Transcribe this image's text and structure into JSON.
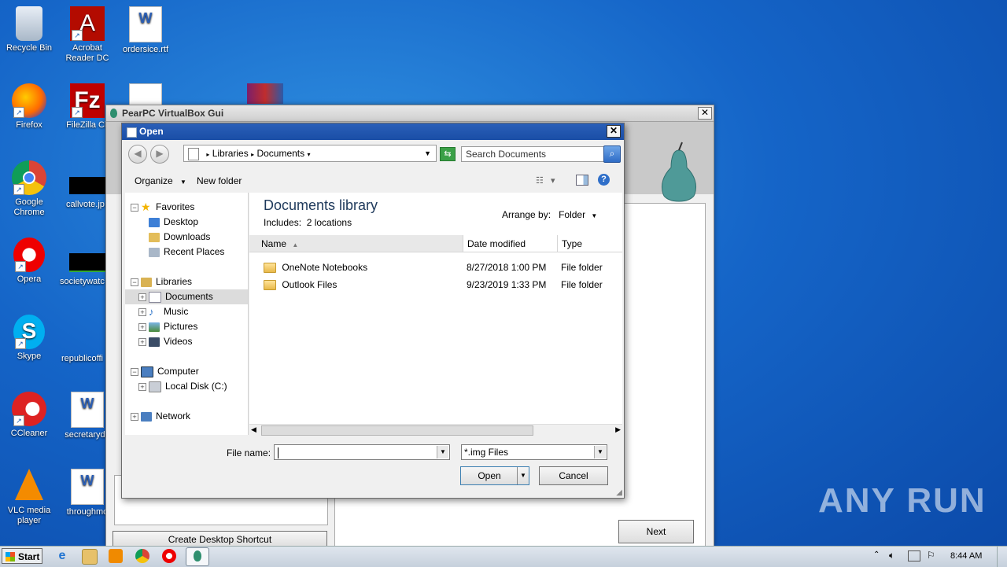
{
  "desktop": {
    "icons": [
      {
        "label": "Recycle Bin"
      },
      {
        "label": "Acrobat\nReader DC"
      },
      {
        "label": "ordersice.rtf"
      },
      {
        "label": "Firefox"
      },
      {
        "label": "FileZilla Cli"
      },
      {
        "label": "Google\nChrome"
      },
      {
        "label": "callvote.jp"
      },
      {
        "label": "Opera"
      },
      {
        "label": "societywatc"
      },
      {
        "label": "Skype"
      },
      {
        "label": "republicoffi"
      },
      {
        "label": "CCleaner"
      },
      {
        "label": "secretaryde"
      },
      {
        "label": "VLC media\nplayer"
      },
      {
        "label": "throughmo"
      }
    ],
    "watermark": "ANY  RUN"
  },
  "pear_window": {
    "title": "PearPC VirtualBox Gui",
    "create_shortcut_label": "Create Desktop Shortcut",
    "next_label": "Next"
  },
  "open_dialog": {
    "title": "Open",
    "breadcrumb": [
      "Libraries",
      "Documents"
    ],
    "search_placeholder": "Search Documents",
    "toolbar": {
      "organize": "Organize",
      "new_folder": "New folder"
    },
    "nav": {
      "favorites": "Favorites",
      "desktop": "Desktop",
      "downloads": "Downloads",
      "recent_places": "Recent Places",
      "libraries": "Libraries",
      "documents": "Documents",
      "music": "Music",
      "pictures": "Pictures",
      "videos": "Videos",
      "computer": "Computer",
      "local_disk": "Local Disk (C:)",
      "network": "Network"
    },
    "library_title": "Documents library",
    "includes": "Includes:",
    "locations": "2 locations",
    "arrange_by_label": "Arrange by:",
    "arrange_by_value": "Folder",
    "columns": {
      "name": "Name",
      "date": "Date modified",
      "type": "Type"
    },
    "files": [
      {
        "name": "OneNote Notebooks",
        "date": "8/27/2018 1:00 PM",
        "type": "File folder"
      },
      {
        "name": "Outlook Files",
        "date": "9/23/2019 1:33 PM",
        "type": "File folder"
      }
    ],
    "file_name_label": "File name:",
    "file_name_value": "",
    "filter_value": "*.img Files",
    "open_label": "Open",
    "cancel_label": "Cancel"
  },
  "taskbar": {
    "start_label": "Start",
    "clock": "8:44 AM"
  }
}
